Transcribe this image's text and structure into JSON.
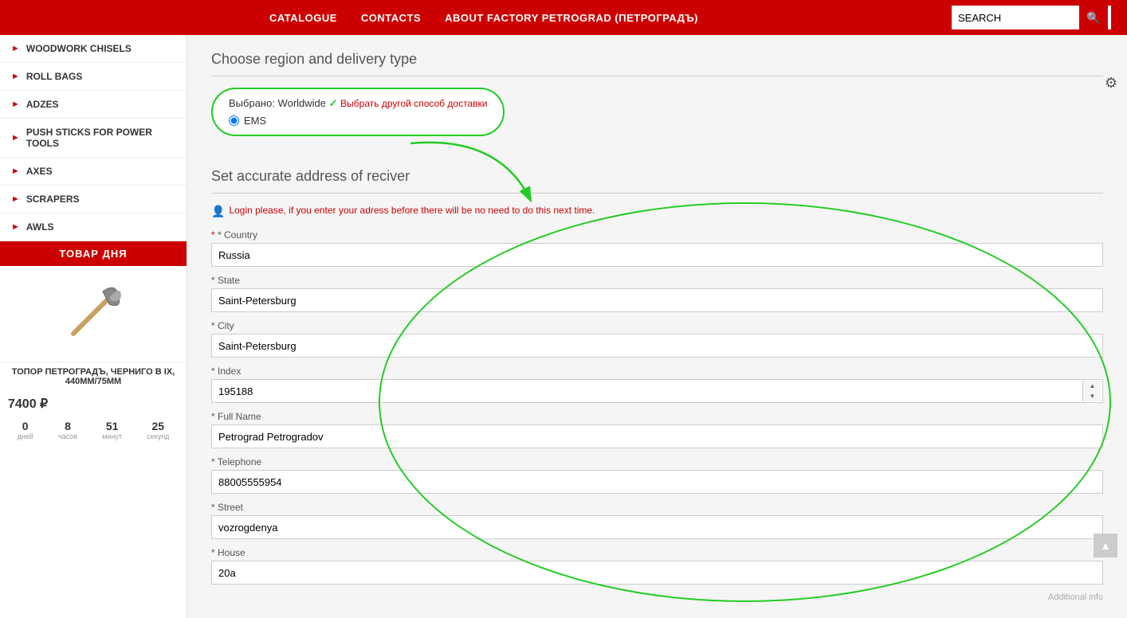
{
  "header": {
    "nav": {
      "catalogue": "CATALOGUE",
      "contacts": "CONTACTS",
      "about": "ABOUT FACTORY PETROGRAD (ПЕТРОГРАДЪ)"
    },
    "search": {
      "placeholder": "SEARCH",
      "button_icon": "🔍"
    }
  },
  "sidebar": {
    "items": [
      {
        "label": "WOODWORK CHISELS"
      },
      {
        "label": "ROLL BAGS"
      },
      {
        "label": "ADZES"
      },
      {
        "label": "PUSH STICKS FOR POWER TOOLS"
      },
      {
        "label": "AXES"
      },
      {
        "label": "SCRAPERS"
      },
      {
        "label": "AWLS"
      }
    ],
    "product_day": {
      "title": "ТОВАР ДНЯ",
      "name": "ТОПОР ПЕТРОГРАДЪ, ЧЕРНИГО В IX, 440ММ/75ММ",
      "price": "7400 ₽",
      "countdown": [
        {
          "value": "0",
          "label": "дней"
        },
        {
          "value": "8",
          "label": "часов"
        },
        {
          "value": "51",
          "label": "минут"
        },
        {
          "value": "25",
          "label": "секунд"
        }
      ]
    }
  },
  "main": {
    "section1_title": "Choose region and delivery type",
    "region": {
      "selected_label": "Выбрано: Worldwide",
      "check_icon": "✓",
      "change_link": "Выбрать другой способ доставки",
      "radio_option": "EMS"
    },
    "section2_title": "Set accurate address of reciver",
    "login_notice": "Login please, if you enter your adress before there will be no need to do this next time.",
    "form": {
      "country_label": "* Country",
      "country_value": "Russia",
      "state_label": "* State",
      "state_value": "Saint-Petersburg",
      "city_label": "* City",
      "city_value": "Saint-Petersburg",
      "index_label": "* Index",
      "index_value": "195188",
      "fullname_label": "* Full Name",
      "fullname_value": "Petrograd Petrogradov",
      "telephone_label": "* Telephone",
      "telephone_value": "88005555954",
      "street_label": "* Street",
      "street_value": "vozrogdenya",
      "house_label": "* House",
      "house_value": "20a",
      "additional_info": "Additional info"
    }
  }
}
